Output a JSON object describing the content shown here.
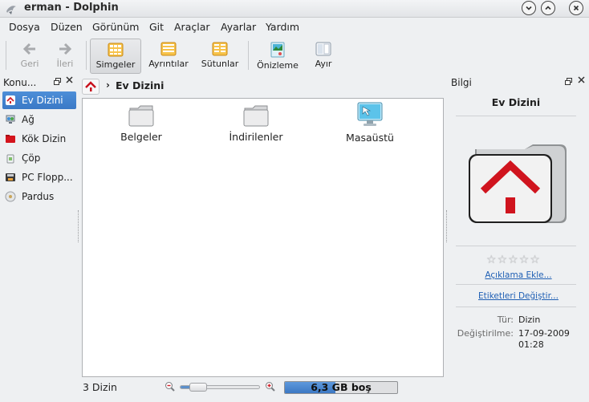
{
  "window": {
    "title": "erman - Dolphin",
    "app_icon": "dolphin-icon"
  },
  "window_buttons": [
    "minimize-icon",
    "maximize-icon",
    "close-icon"
  ],
  "menu": [
    "Dosya",
    "Düzen",
    "Görünüm",
    "Git",
    "Araçlar",
    "Ayarlar",
    "Yardım"
  ],
  "toolbar": {
    "back": "Geri",
    "forward": "İleri",
    "icons_view": "Simgeler",
    "details_view": "Ayrıntılar",
    "columns_view": "Sütunlar",
    "preview": "Önizleme",
    "split": "Ayır"
  },
  "places": {
    "title": "Konu...",
    "items": [
      {
        "label": "Ev Dizini",
        "icon": "home-icon",
        "selected": true
      },
      {
        "label": "Ağ",
        "icon": "network-icon"
      },
      {
        "label": "Kök Dizin",
        "icon": "root-folder-icon"
      },
      {
        "label": "Çöp",
        "icon": "trash-icon"
      },
      {
        "label": "PC Flopp...",
        "icon": "floppy-icon"
      },
      {
        "label": "Pardus",
        "icon": "disc-icon"
      }
    ]
  },
  "breadcrumb": {
    "current": "Ev Dizini"
  },
  "files": [
    {
      "name": "Belgeler",
      "icon": "folder-icon"
    },
    {
      "name": "İndirilenler",
      "icon": "folder-icon"
    },
    {
      "name": "Masaüstü",
      "icon": "desktop-icon"
    }
  ],
  "status": {
    "count": "3 Dizin",
    "zoom_fraction": 0.22,
    "disk_text": "6,3 GB boş",
    "disk_used_fraction": 0.45
  },
  "info": {
    "title": "Bilgi",
    "heading": "Ev Dizini",
    "rating": 0,
    "add_comment": "Açıklama Ekle...",
    "change_tags": "Etiketleri Değiştir...",
    "type_label": "Tür:",
    "type_value": "Dizin",
    "modified_label": "Değiştirilme:",
    "modified_date": "17-09-2009",
    "modified_time": "01:28"
  },
  "colors": {
    "selection": "#3f7fcc",
    "link": "#1f5fb4",
    "disk_fill": "#4a86cf"
  }
}
